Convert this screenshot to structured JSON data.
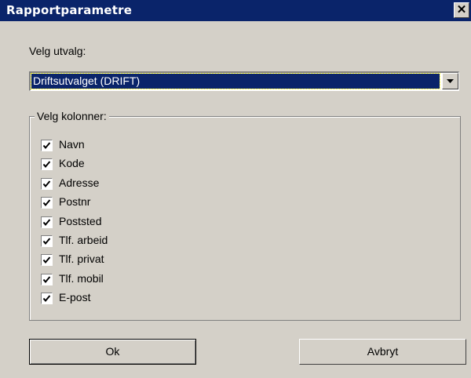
{
  "window": {
    "title": "Rapportparametre",
    "close_label": "✕"
  },
  "selection": {
    "label": "Velg utvalg:",
    "value": "Driftsutvalget (DRIFT)"
  },
  "columns": {
    "legend": "Velg kolonner:",
    "items": [
      {
        "label": "Navn",
        "checked": true
      },
      {
        "label": "Kode",
        "checked": true
      },
      {
        "label": "Adresse",
        "checked": true
      },
      {
        "label": "Postnr",
        "checked": true
      },
      {
        "label": "Poststed",
        "checked": true
      },
      {
        "label": "Tlf. arbeid",
        "checked": true
      },
      {
        "label": "Tlf. privat",
        "checked": true
      },
      {
        "label": "Tlf. mobil",
        "checked": true
      },
      {
        "label": "E-post",
        "checked": true
      }
    ]
  },
  "buttons": {
    "ok_label": "Ok",
    "cancel_label": "Avbryt"
  },
  "colors": {
    "titlebar": "#0a246a",
    "face": "#d4d0c8",
    "selection": "#0a246a"
  }
}
